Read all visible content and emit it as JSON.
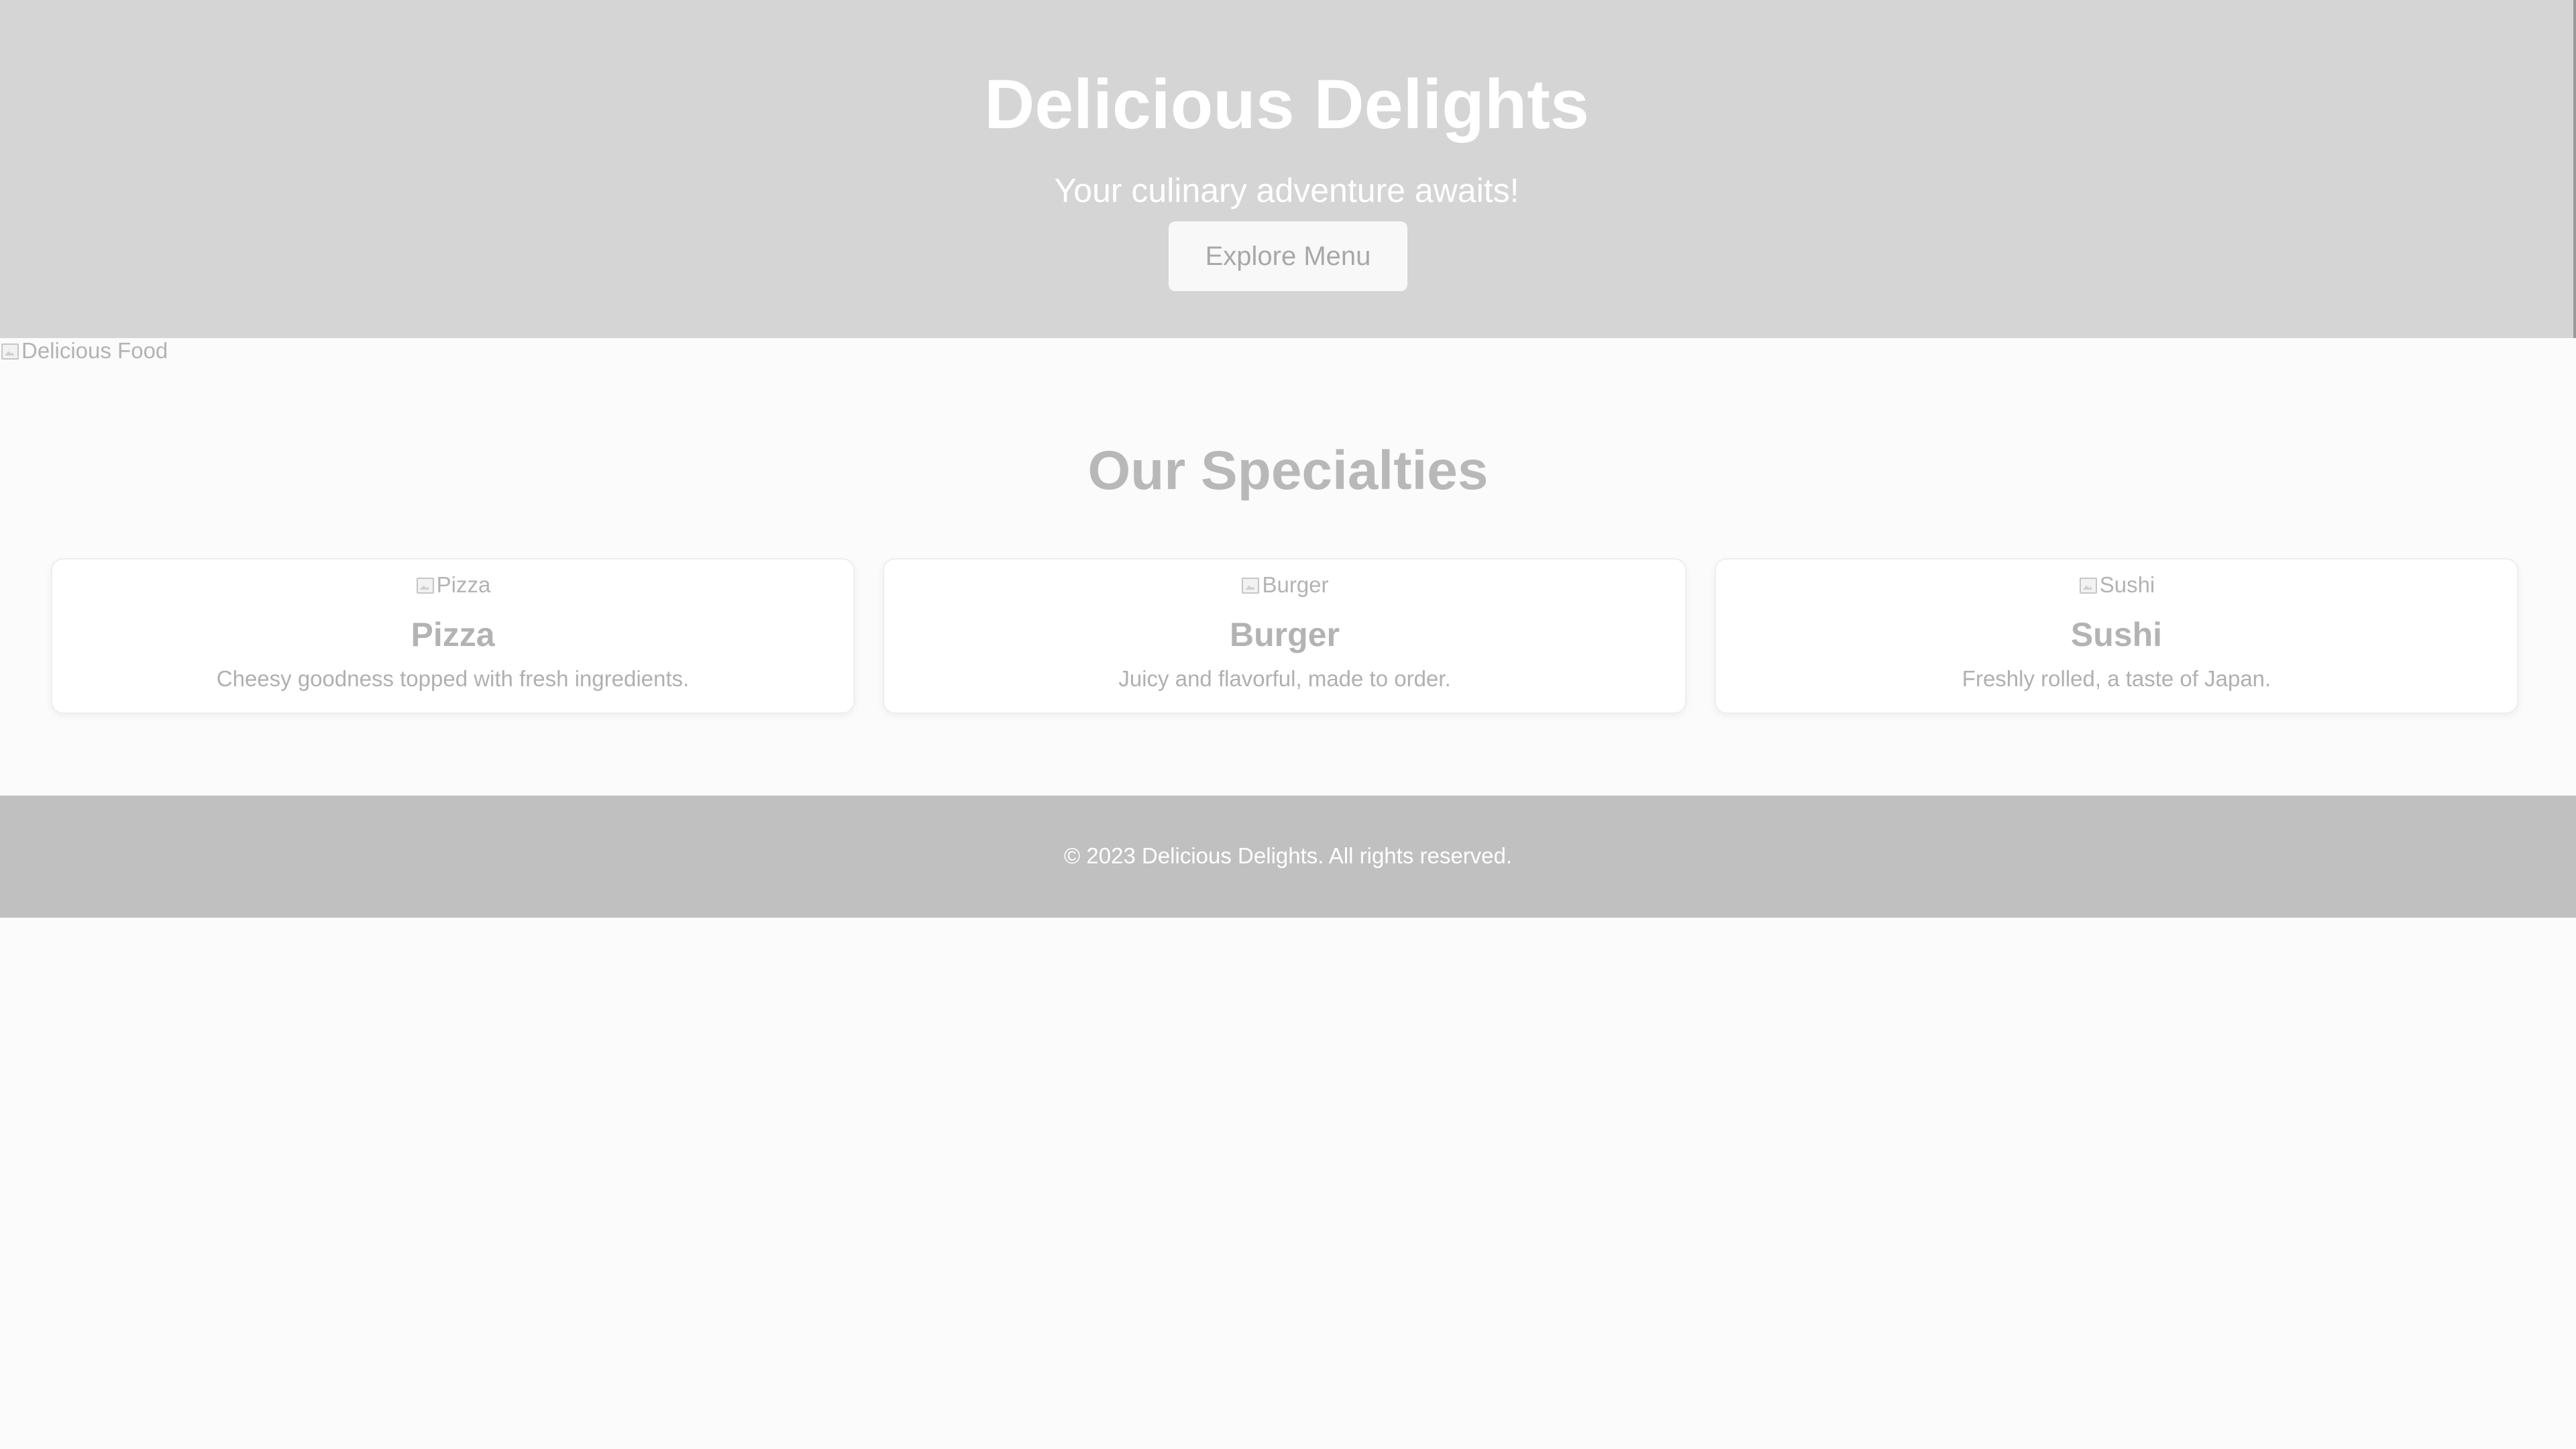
{
  "hero": {
    "title": "Delicious Delights",
    "subtitle": "Your culinary adventure awaits!",
    "button_label": "Explore Menu",
    "background_color": "#d5d5d5"
  },
  "hero_image": {
    "alt": "Delicious Food",
    "icon": "broken-image-icon"
  },
  "specialties": {
    "title": "Our Specialties",
    "cards": [
      {
        "image_alt": "Pizza",
        "title": "Pizza",
        "description": "Cheesy goodness topped with fresh ingredients."
      },
      {
        "image_alt": "Burger",
        "title": "Burger",
        "description": "Juicy and flavorful, made to order."
      },
      {
        "image_alt": "Sushi",
        "title": "Sushi",
        "description": "Freshly rolled, a taste of Japan."
      }
    ]
  },
  "footer": {
    "text": "© 2023 Delicious Delights. All rights reserved.",
    "background_color": "#c0c0c0"
  }
}
